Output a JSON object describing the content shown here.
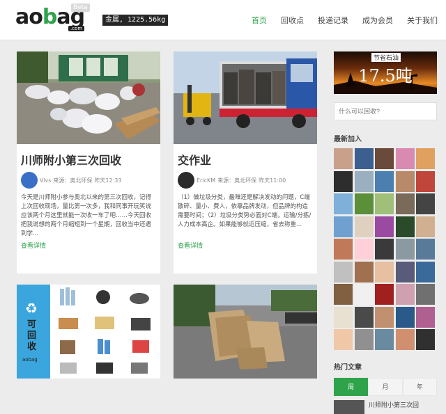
{
  "brand": {
    "name_pre": "ao",
    "name_g": "b",
    "name_post": "ag",
    "com": ".com",
    "beta": "Beta"
  },
  "gold": "金属, 1225.56kg",
  "nav": [
    "首页",
    "回收点",
    "投递记录",
    "成为会员",
    "关于我们"
  ],
  "posts": [
    {
      "title": "川师附小第三次回收",
      "author": "Vivs",
      "source": "来源：奥北环保",
      "time": "昨天12:33",
      "excerpt": "今天是川师附小参与奥北以来的第三次回收，记得上次回收现场，量比第一次多，我和同事开玩笑说应该两个月这里就能一次收一车了吧……今天回收把我说想的两个月缩短到一个星期，回收当中还遇到学...",
      "more": "查看详情"
    },
    {
      "title": "交作业",
      "author": "EricKM",
      "source": "来源：奥北环保",
      "time": "昨天11:00",
      "excerpt": "（1）做垃圾分类，最难还是解决发动的问题，C端散碎、量小、费人，依靠品牌发动，但品牌的构造需要时间；（2）垃圾分类势必面对C端，运输/分拣/人力成本高企。如果能够就近压缩，省去称重...",
      "more": "查看详情"
    }
  ],
  "lower_cards": {
    "recyclable": {
      "label": "可回收",
      "brand": "aobag",
      "items": [
        "矿泉水瓶",
        "饮料瓶",
        "锅具",
        "纸箱",
        "衣物",
        "易拉罐",
        "书籍",
        "旧家电",
        "塑料",
        "报纸",
        "电线",
        "纸盒"
      ]
    }
  },
  "sidebar": {
    "oil_tag": "节省石油",
    "oil_value": "17.5吨",
    "search_placeholder": "什么可以回收?",
    "new_join": "最新加入",
    "hot": "热门文章",
    "tabs": [
      "周",
      "月",
      "年"
    ],
    "hot_first": "川师附小第三次回"
  },
  "colors": {
    "accent": "#2ea34a"
  }
}
